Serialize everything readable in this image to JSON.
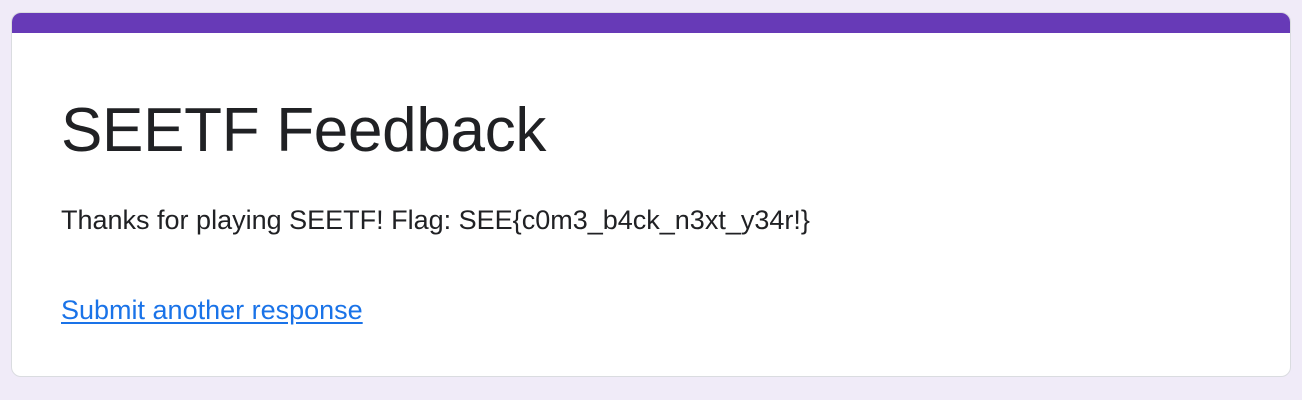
{
  "form": {
    "title": "SEETF Feedback",
    "confirmation_message": "Thanks for playing SEETF! Flag: SEE{c0m3_b4ck_n3xt_y34r!}",
    "submit_another_label": "Submit another response"
  },
  "colors": {
    "page_background": "#F0EBF8",
    "accent": "#673AB7",
    "link": "#1a73e8",
    "text": "#202124"
  }
}
